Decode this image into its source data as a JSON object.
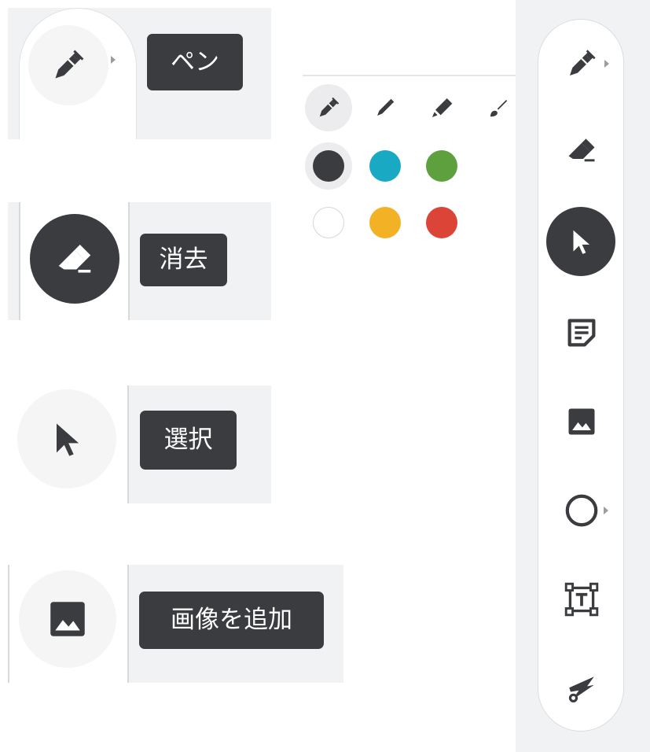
{
  "tooltips": {
    "pen": "ペン",
    "eraser": "消去",
    "select": "選択",
    "add_image": "画像を追加"
  },
  "colors": {
    "tooltip_bg": "#3a3c3f",
    "panel_bg": "#f1f2f4",
    "active": "#3a3c3f"
  },
  "pen_types": [
    "pen-icon",
    "marker-icon",
    "highlighter-icon",
    "brush-icon"
  ],
  "swatches": [
    {
      "name": "charcoal",
      "color": "#3a3c3f",
      "selected": true
    },
    {
      "name": "cyan",
      "color": "#1aa9c3",
      "selected": false
    },
    {
      "name": "green",
      "color": "#5ea03e",
      "selected": false
    },
    {
      "name": "white",
      "color": "#ffffff",
      "selected": false
    },
    {
      "name": "yellow",
      "color": "#f3b125",
      "selected": false
    },
    {
      "name": "red",
      "color": "#db4437",
      "selected": false
    }
  ],
  "toolbar": {
    "items": [
      "pen-icon",
      "eraser-icon",
      "select-arrow-icon",
      "sticky-note-icon",
      "image-icon",
      "circle-shape-icon",
      "text-box-icon",
      "laser-icon"
    ],
    "active": "select-arrow-icon"
  }
}
